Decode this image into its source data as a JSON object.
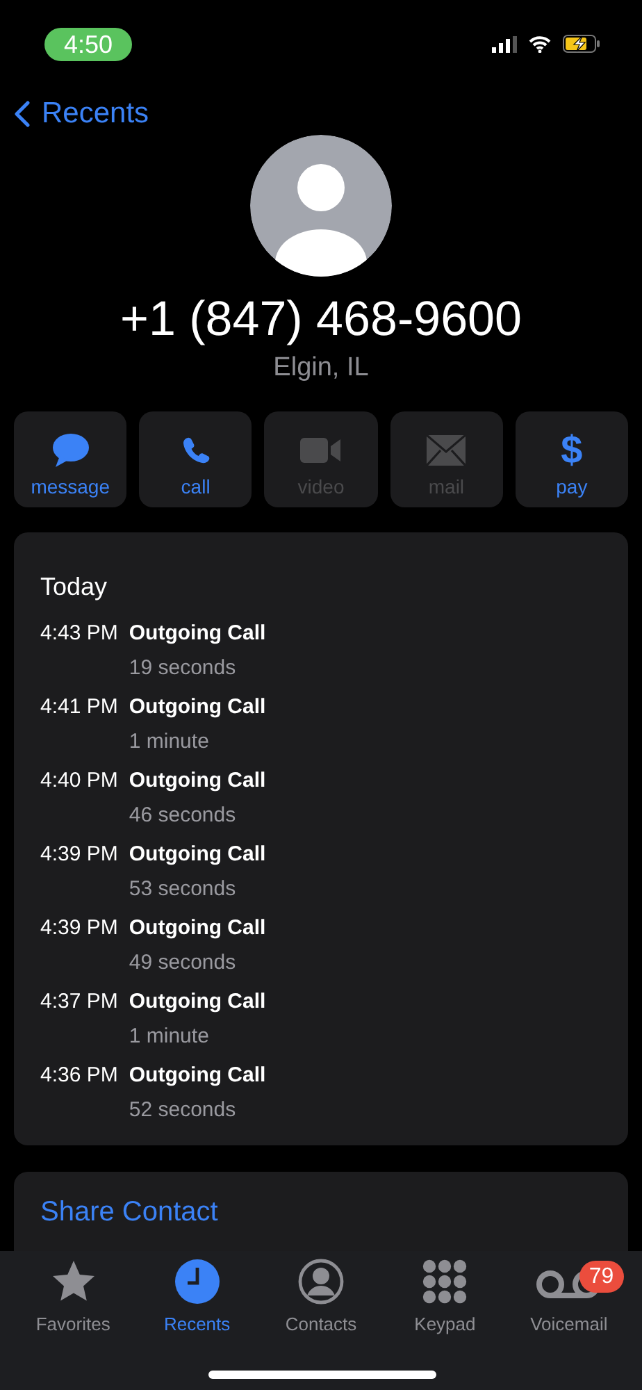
{
  "status_bar": {
    "time": "4:50"
  },
  "nav": {
    "back": "Recents"
  },
  "contact": {
    "number": "+1 (847) 468-9600",
    "location": "Elgin, IL"
  },
  "actions": [
    {
      "kind": "message",
      "label": "message",
      "disabled": false
    },
    {
      "kind": "call",
      "label": "call",
      "disabled": false
    },
    {
      "kind": "video",
      "label": "video",
      "disabled": true
    },
    {
      "kind": "mail",
      "label": "mail",
      "disabled": true
    },
    {
      "kind": "pay",
      "label": "pay",
      "glyph": "$",
      "disabled": false
    }
  ],
  "history": {
    "heading": "Today",
    "calls": [
      {
        "time": "4:43 PM",
        "type": "Outgoing Call",
        "duration": "19 seconds"
      },
      {
        "time": "4:41 PM",
        "type": "Outgoing Call",
        "duration": "1 minute"
      },
      {
        "time": "4:40 PM",
        "type": "Outgoing Call",
        "duration": "46 seconds"
      },
      {
        "time": "4:39 PM",
        "type": "Outgoing Call",
        "duration": "53 seconds"
      },
      {
        "time": "4:39 PM",
        "type": "Outgoing Call",
        "duration": "49 seconds"
      },
      {
        "time": "4:37 PM",
        "type": "Outgoing Call",
        "duration": "1 minute"
      },
      {
        "time": "4:36 PM",
        "type": "Outgoing Call",
        "duration": "52 seconds"
      }
    ]
  },
  "share": {
    "label": "Share Contact"
  },
  "tabs": [
    {
      "kind": "favorites",
      "label": "Favorites",
      "selected": false
    },
    {
      "kind": "recents",
      "label": "Recents",
      "selected": true
    },
    {
      "kind": "contacts",
      "label": "Contacts",
      "selected": false
    },
    {
      "kind": "keypad",
      "label": "Keypad",
      "selected": false
    },
    {
      "kind": "voicemail",
      "label": "Voicemail",
      "selected": false,
      "badge": "79"
    }
  ]
}
